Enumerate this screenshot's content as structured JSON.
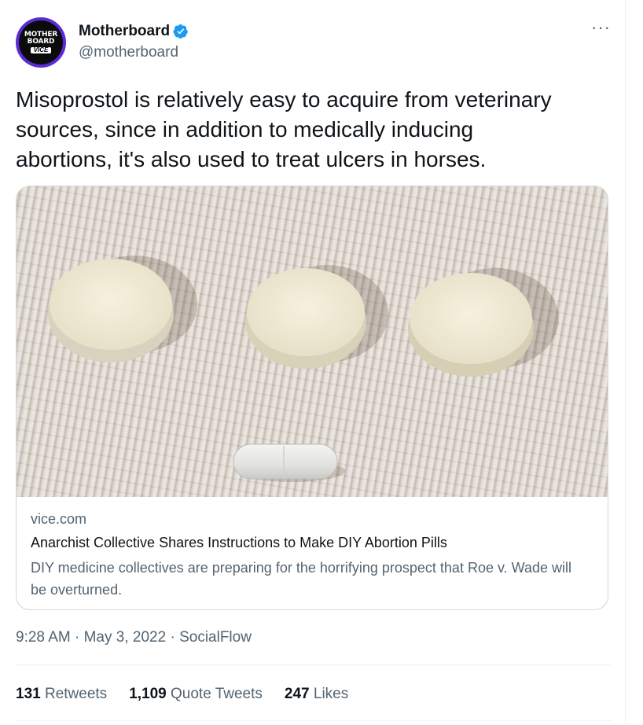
{
  "author": {
    "display_name": "Motherboard",
    "handle": "@motherboard",
    "avatar_text": [
      "MOTHER",
      "BOARD",
      "VICE"
    ],
    "verified_icon": "verified-badge-icon"
  },
  "more_icon": "more-options-icon",
  "tweet": {
    "text": "Misoprostol is relatively easy to acquire from veterinary\nsources, since in addition to medically inducing\nabortions, it's also used to treat ulcers in horses."
  },
  "card": {
    "image_alt": "photo of white pills and a capsule on a paper towel",
    "domain": "vice.com",
    "title": "Anarchist Collective Shares Instructions to Make DIY Abortion Pills",
    "description": "DIY medicine collectives are preparing for the horrifying prospect that Roe v. Wade will be overturned."
  },
  "meta": {
    "time": "9:28 AM",
    "sep1": " · ",
    "date": "May 3, 2022",
    "sep2": " · ",
    "source": "SocialFlow"
  },
  "stats": {
    "retweets_count": "131",
    "retweets_label": "Retweets",
    "quotes_count": "1,109",
    "quotes_label": "Quote Tweets",
    "likes_count": "247",
    "likes_label": "Likes"
  },
  "colors": {
    "verified": "#1d9bf0",
    "secondary_text": "#536471",
    "primary_text": "#0f1419",
    "border": "#cfd9de"
  }
}
